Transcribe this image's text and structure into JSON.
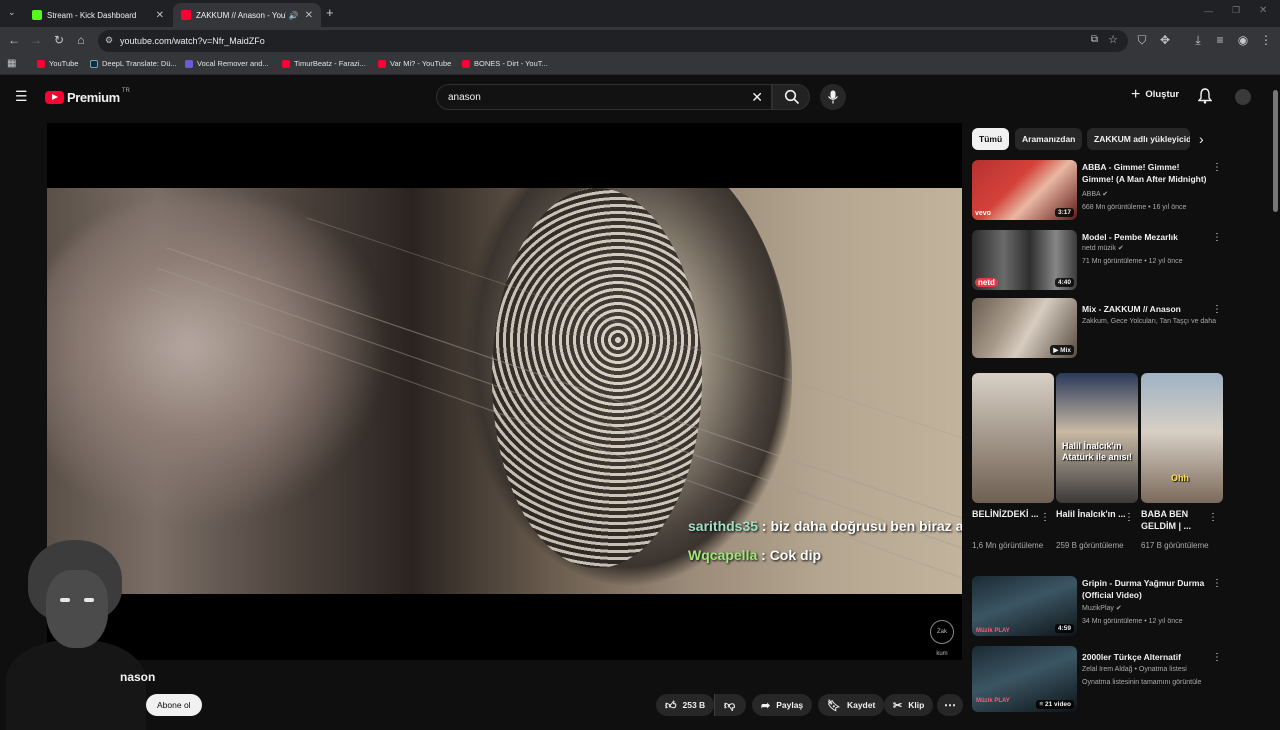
{
  "browser": {
    "tabs": [
      {
        "title": "Stream - Kick Dashboard",
        "favicon_color": "#53fc18"
      },
      {
        "title": "ZAKKUM // Anason - YouTube",
        "favicon_color": "#ff0033"
      }
    ],
    "url": "youtube.com/watch?v=Nfr_MaidZFo",
    "bookmarks": [
      {
        "label": "YouTube",
        "color": "#ff0033"
      },
      {
        "label": "DeepL Translate: Dü...",
        "color": "#0f2b46"
      },
      {
        "label": "Vocal Remover and...",
        "color": "#6b5bd6"
      },
      {
        "label": "TimurBeatz - Farazi...",
        "color": "#ff0033"
      },
      {
        "label": "Var Mi? - YouTube",
        "color": "#ff0033"
      },
      {
        "label": "BONES - Dirt - YouT...",
        "color": "#ff0033"
      }
    ]
  },
  "masthead": {
    "logo_text": "Premium",
    "logo_sup": "TR",
    "search_value": "anason",
    "create_label": "Oluştur"
  },
  "player": {
    "chat": [
      {
        "user": "sarithds35",
        "message": " : biz daha doğrusu ben biraz abartmış"
      },
      {
        "user": "Wqcapella",
        "message": " : Cok dip"
      }
    ],
    "watermark": "Zak kum"
  },
  "below": {
    "title_fragment": "nason",
    "subscribe_label": "Abone ol",
    "like_count": "253 B",
    "share_label": "Paylaş",
    "save_label": "Kaydet",
    "clip_label": "Klip"
  },
  "sidebar": {
    "chips": [
      "Tümü",
      "Aramanızdan",
      "ZAKKUM adlı yükleyiciden"
    ],
    "recs": [
      {
        "title": "ABBA - Gimme! Gimme! Gimme! (A Man After Midnight)",
        "channel": "ABBA",
        "verified": true,
        "meta": "668 Mn görüntüleme • 16 yıl önce",
        "duration": "3:17",
        "badge": "vevo"
      },
      {
        "title": "Model - Pembe Mezarlık",
        "channel": "netd müzik",
        "verified": true,
        "meta": "71 Mn görüntüleme • 12 yıl önce",
        "duration": "4:40",
        "badge": "netd"
      },
      {
        "title": "Mix - ZAKKUM // Anason",
        "channel": "Zakkum, Gece Yolcuları, Tan Taşçı ve daha fazlası",
        "verified": false,
        "meta": "",
        "duration": "Mix",
        "badge": ""
      }
    ],
    "shorts": [
      {
        "title": "BELİNİZDEKİ ...",
        "views": "1,6 Mn görüntüleme",
        "overlay": ""
      },
      {
        "title": "Halil İnalcık'ın ...",
        "views": "259 B görüntüleme",
        "overlay": "Halil İnalcık'ın Atatürk ile anısı!"
      },
      {
        "title": "BABA BEN GELDİM | ...",
        "views": "617 B görüntüleme",
        "overlay": "Ohh"
      }
    ],
    "recs2": [
      {
        "title": "Gripin - Durma Yağmur Durma (Official Video)",
        "channel": "MuzikPlay",
        "verified": true,
        "meta": "34 Mn görüntüleme • 12 yıl önce",
        "duration": "4:59",
        "badge": "Müzik PLAY"
      },
      {
        "title": "2000ler Türkçe Alternatif",
        "channel": "Zelal İrem Aldağ • Oynatma listesi",
        "verified": false,
        "meta": "Oynatma listesinin tamamını görüntüle",
        "duration": "21 video",
        "badge": "Müzik PLAY"
      }
    ]
  }
}
